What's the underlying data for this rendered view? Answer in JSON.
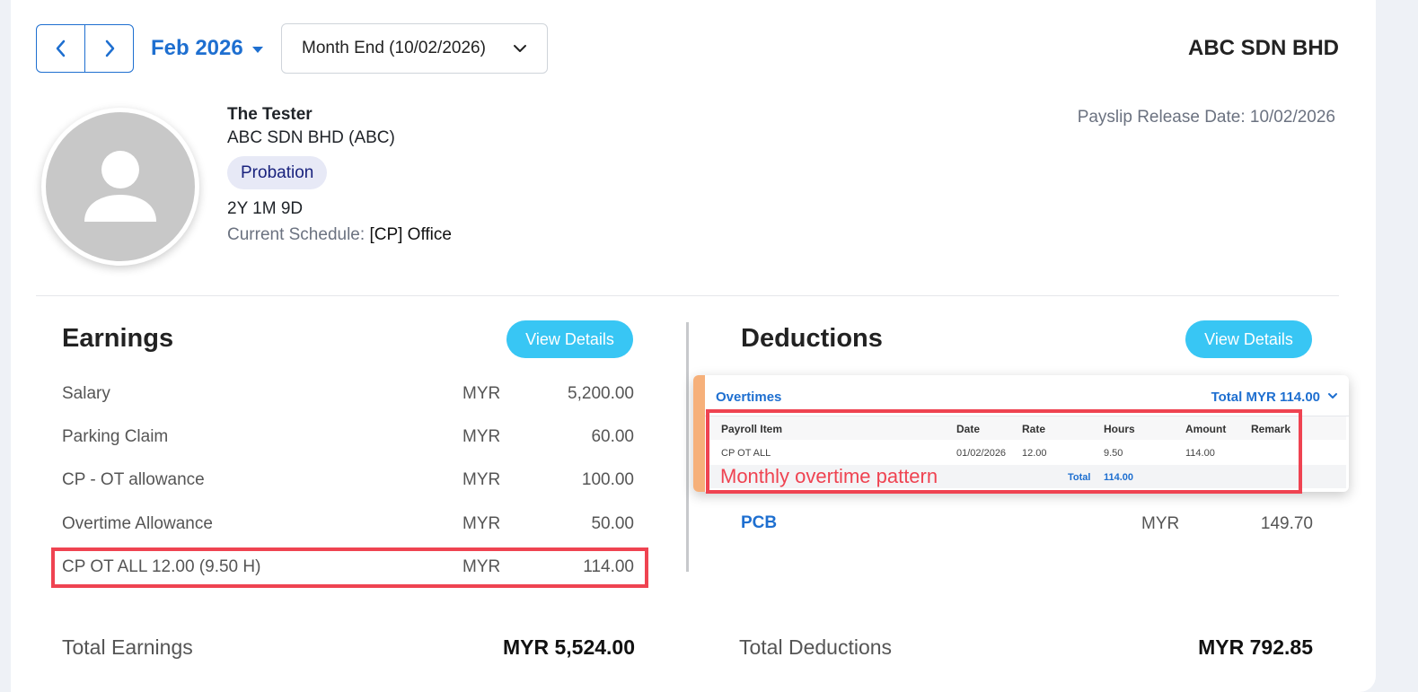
{
  "header": {
    "period": "Feb 2026",
    "payroll_select": "Month End (10/02/2026)",
    "company": "ABC SDN BHD"
  },
  "employee": {
    "name": "The Tester",
    "company": "ABC SDN BHD (ABC)",
    "status": "Probation",
    "tenure": "2Y 1M 9D",
    "schedule_label": "Current Schedule:",
    "schedule_value": "[CP] Office",
    "release_date": "Payslip Release Date: 10/02/2026"
  },
  "earnings": {
    "title": "Earnings",
    "view_details": "View Details",
    "rows": [
      {
        "label": "Salary",
        "currency": "MYR",
        "amount": "5,200.00"
      },
      {
        "label": "Parking Claim",
        "currency": "MYR",
        "amount": "60.00"
      },
      {
        "label": "CP - OT allowance",
        "currency": "MYR",
        "amount": "100.00"
      },
      {
        "label": "Overtime Allowance",
        "currency": "MYR",
        "amount": "50.00"
      },
      {
        "label": "CP OT ALL 12.00 (9.50 H)",
        "currency": "MYR",
        "amount": "114.00"
      }
    ],
    "total_label": "Total Earnings",
    "total_value": "MYR 5,524.00"
  },
  "deductions": {
    "title": "Deductions",
    "view_details": "View Details",
    "rows": [
      {
        "label": "PCB",
        "currency": "MYR",
        "amount": "149.70"
      }
    ],
    "total_label": "Total Deductions",
    "total_value": "MYR 792.85"
  },
  "overtime_popup": {
    "title": "Overtimes",
    "total": "Total MYR 114.00",
    "columns": [
      "Payroll Item",
      "Date",
      "Rate",
      "Hours",
      "Amount",
      "Remark"
    ],
    "row": {
      "item": "CP OT ALL",
      "date": "01/02/2026",
      "rate": "12.00",
      "hours": "9.50",
      "amount": "114.00",
      "remark": ""
    },
    "total_label": "Total",
    "total_amount": "114.00"
  },
  "annotation": "Monthly overtime pattern"
}
